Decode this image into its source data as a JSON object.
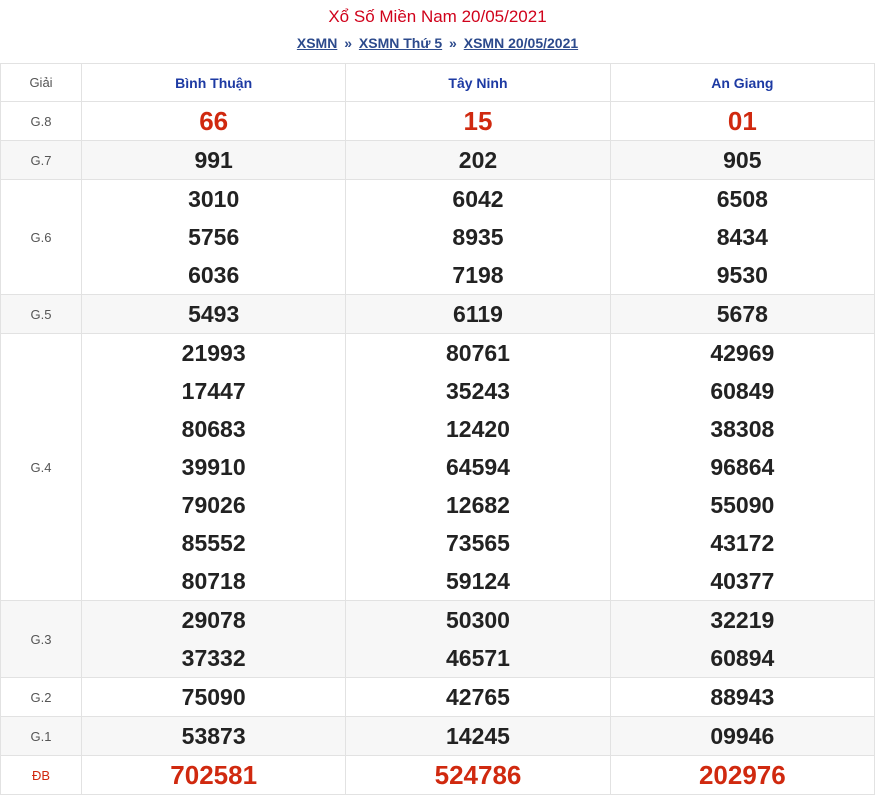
{
  "header": {
    "title": "Xổ Số Miền Nam 20/05/2021",
    "crumbs": [
      "XSMN",
      "XSMN Thứ 5",
      "XSMN 20/05/2021"
    ],
    "separator": "»"
  },
  "table": {
    "giai_header": "Giải",
    "provinces": [
      "Bình Thuận",
      "Tây Ninh",
      "An Giang"
    ],
    "rows": [
      {
        "label": "G.8",
        "values": [
          [
            "66"
          ],
          [
            "15"
          ],
          [
            "01"
          ]
        ],
        "highlight": true,
        "alt": false
      },
      {
        "label": "G.7",
        "values": [
          [
            "991"
          ],
          [
            "202"
          ],
          [
            "905"
          ]
        ],
        "highlight": false,
        "alt": true
      },
      {
        "label": "G.6",
        "values": [
          [
            "3010",
            "5756",
            "6036"
          ],
          [
            "6042",
            "8935",
            "7198"
          ],
          [
            "6508",
            "8434",
            "9530"
          ]
        ],
        "highlight": false,
        "alt": false
      },
      {
        "label": "G.5",
        "values": [
          [
            "5493"
          ],
          [
            "6119"
          ],
          [
            "5678"
          ]
        ],
        "highlight": false,
        "alt": true
      },
      {
        "label": "G.4",
        "values": [
          [
            "21993",
            "17447",
            "80683",
            "39910",
            "79026",
            "85552",
            "80718"
          ],
          [
            "80761",
            "35243",
            "12420",
            "64594",
            "12682",
            "73565",
            "59124"
          ],
          [
            "42969",
            "60849",
            "38308",
            "96864",
            "55090",
            "43172",
            "40377"
          ]
        ],
        "highlight": false,
        "alt": false
      },
      {
        "label": "G.3",
        "values": [
          [
            "29078",
            "37332"
          ],
          [
            "50300",
            "46571"
          ],
          [
            "32219",
            "60894"
          ]
        ],
        "highlight": false,
        "alt": true
      },
      {
        "label": "G.2",
        "values": [
          [
            "75090"
          ],
          [
            "42765"
          ],
          [
            "88943"
          ]
        ],
        "highlight": false,
        "alt": false
      },
      {
        "label": "G.1",
        "values": [
          [
            "53873"
          ],
          [
            "14245"
          ],
          [
            "09946"
          ]
        ],
        "highlight": false,
        "alt": true
      },
      {
        "label": "ĐB",
        "values": [
          [
            "702581"
          ],
          [
            "524786"
          ],
          [
            "202976"
          ]
        ],
        "highlight": true,
        "alt": false
      }
    ]
  },
  "colors": {
    "title": "#d0021b",
    "link": "#2c4a8c",
    "province": "#1d3aa3",
    "highlight_number": "#d0290f",
    "number": "#222222"
  }
}
